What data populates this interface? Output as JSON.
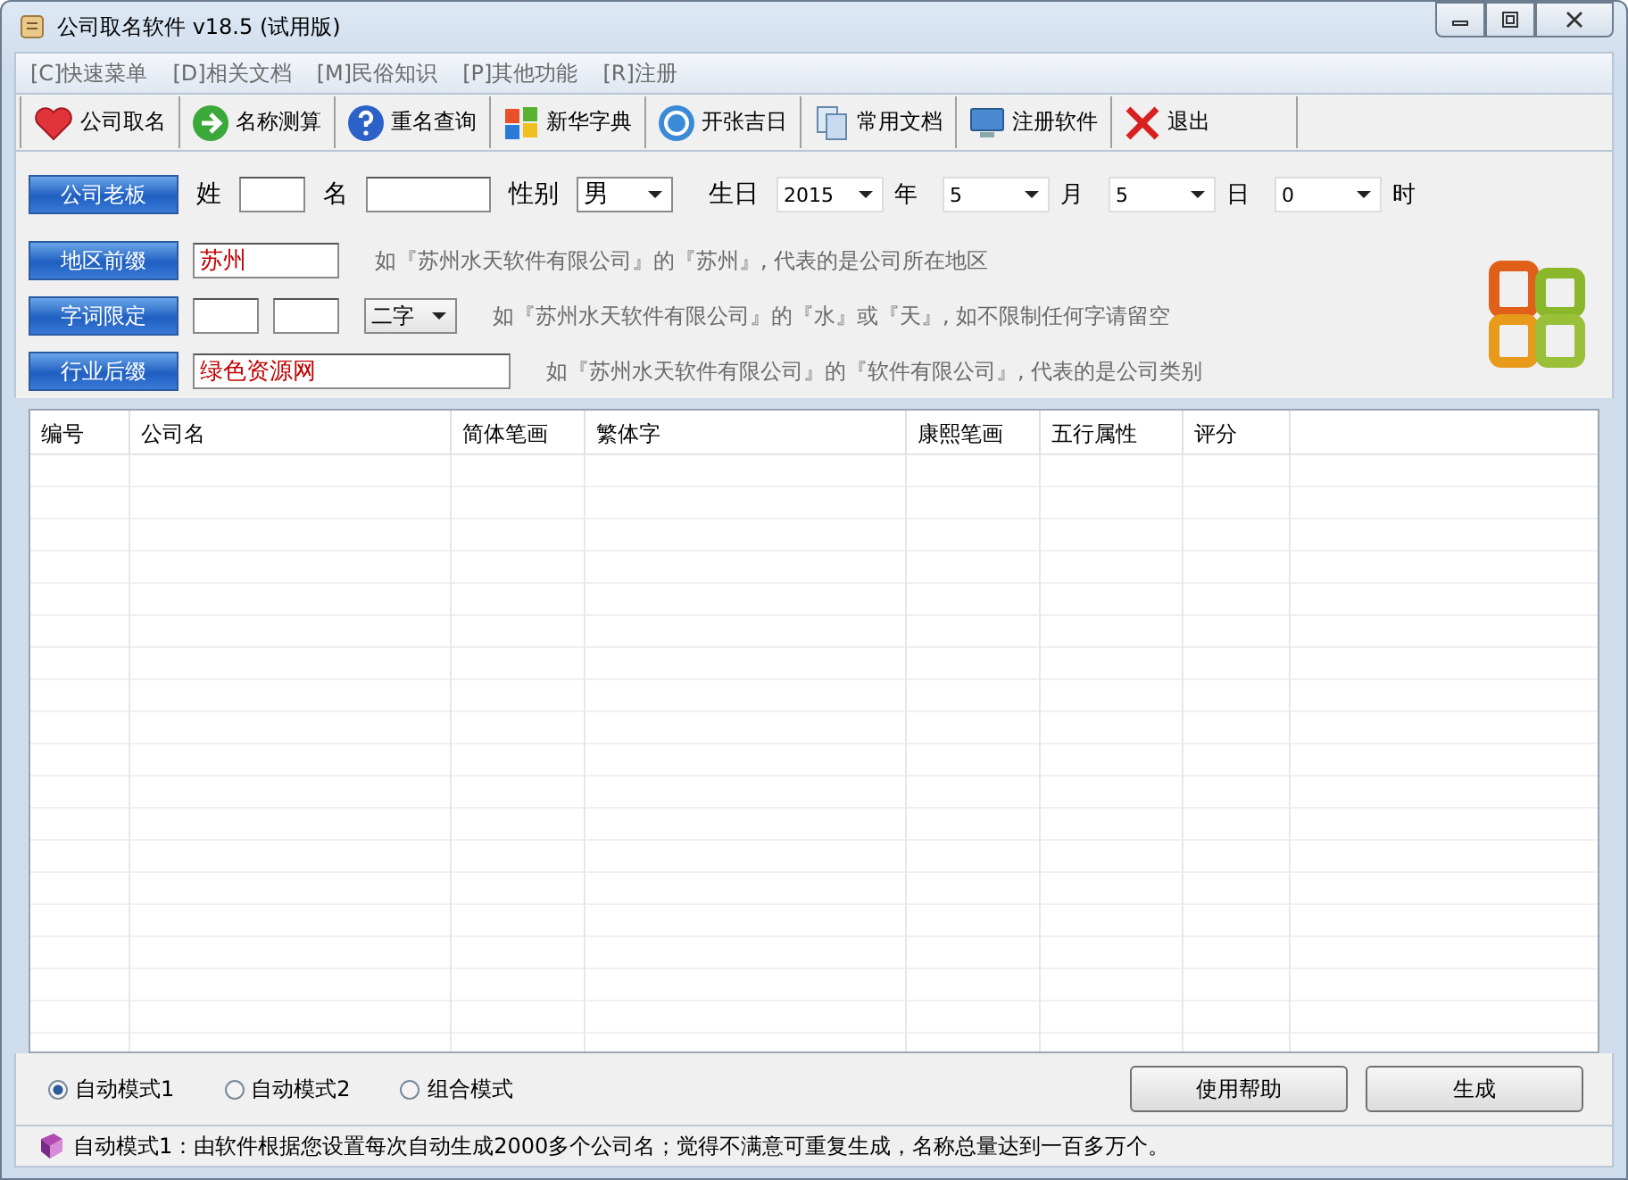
{
  "window": {
    "title": "公司取名软件 v18.5 (试用版)"
  },
  "menu": [
    "[C]快速菜单",
    "[D]相关文档",
    "[M]民俗知识",
    "[P]其他功能",
    "[R]注册"
  ],
  "toolbar": [
    "公司取名",
    "名称测算",
    "重名查询",
    "新华字典",
    "开张吉日",
    "常用文档",
    "注册软件",
    "退出"
  ],
  "owner": {
    "button": "公司老板",
    "surname_label": "姓",
    "name_label": "名",
    "gender_label": "性别",
    "gender": "男",
    "birthday_label": "生日",
    "date": [
      {
        "value": "2015",
        "unit": "年"
      },
      {
        "value": "5",
        "unit": "月"
      },
      {
        "value": "5",
        "unit": "日"
      },
      {
        "value": "0",
        "unit": "时"
      }
    ]
  },
  "region": {
    "button": "地区前缀",
    "value": "苏州",
    "hint": "如『苏州水天软件有限公司』的『苏州』, 代表的是公司所在地区"
  },
  "chars": {
    "button": "字词限定",
    "count": "二字",
    "hint": "如『苏州水天软件有限公司』的『水』或『天』, 如不限制任何字请留空"
  },
  "industry": {
    "button": "行业后缀",
    "value": "绿色资源网",
    "hint": "如『苏州水天软件有限公司』的『软件有限公司』, 代表的是公司类别"
  },
  "table": {
    "columns": [
      "编号",
      "公司名",
      "简体笔画",
      "繁体字",
      "康熙笔画",
      "五行属性",
      "评分"
    ]
  },
  "modes": [
    {
      "label": "自动模式1",
      "selected": true
    },
    {
      "label": "自动模式2",
      "selected": false
    },
    {
      "label": "组合模式",
      "selected": false
    }
  ],
  "buttons": [
    "使用帮助",
    "生成"
  ],
  "status_bar": "自动模式1：由软件根据您设置每次自动生成2000多个公司名；觉得不满意可重复生成，名称总量达到一百多万个。"
}
